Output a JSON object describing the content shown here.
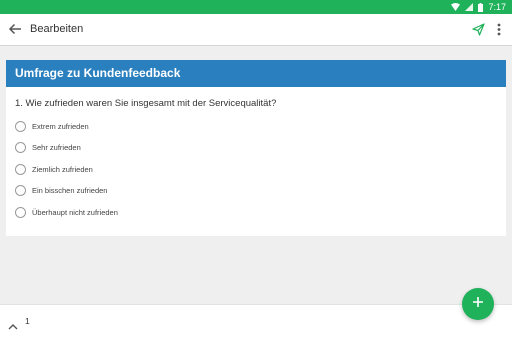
{
  "status_bar": {
    "time": "7:17"
  },
  "app_bar": {
    "title": "Bearbeiten"
  },
  "survey": {
    "title": "Umfrage zu Kundenfeedback",
    "question": "1. Wie zufrieden waren Sie insgesamt mit der Servicequalität?",
    "options": [
      "Extrem zufrieden",
      "Sehr zufrieden",
      "Ziemlich zufrieden",
      "Ein bisschen zufrieden",
      "Überhaupt nicht zufrieden"
    ]
  },
  "footer": {
    "page": "1"
  },
  "colors": {
    "primary": "#20b15b",
    "survey_header": "#2a7fbf"
  },
  "icons": [
    "wifi-icon",
    "signal-icon",
    "battery-icon",
    "back-arrow-icon",
    "send-icon",
    "more-vert-icon",
    "chevron-up-icon",
    "plus-icon"
  ]
}
